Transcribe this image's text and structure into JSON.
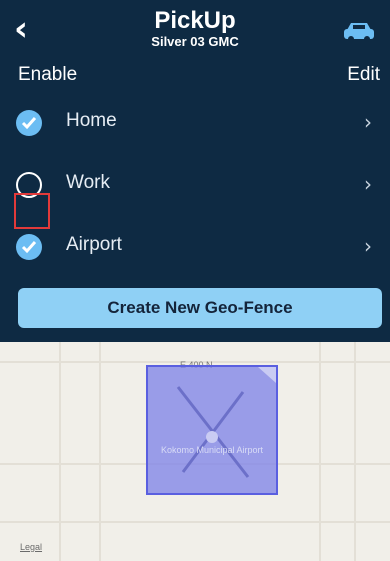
{
  "header": {
    "back_icon": "chevron-left-icon",
    "title": "PickUp",
    "subtitle": "Silver 03 GMC",
    "car_icon": "car-icon"
  },
  "actions": {
    "enable_label": "Enable",
    "edit_label": "Edit"
  },
  "fences": [
    {
      "label": "Home",
      "enabled": true
    },
    {
      "label": "Work",
      "enabled": false
    },
    {
      "label": "Airport",
      "enabled": true
    }
  ],
  "create_button": "Create New Geo-Fence",
  "map": {
    "road_label": "E 400 N",
    "airport_label": "Kokomo Municipal Airport",
    "legal_label": "Legal"
  },
  "colors": {
    "panel_bg": "#0e2a43",
    "accent": "#6cbdf3",
    "button_bg": "#8fd0f5",
    "fence_fill": "#8084e8"
  }
}
